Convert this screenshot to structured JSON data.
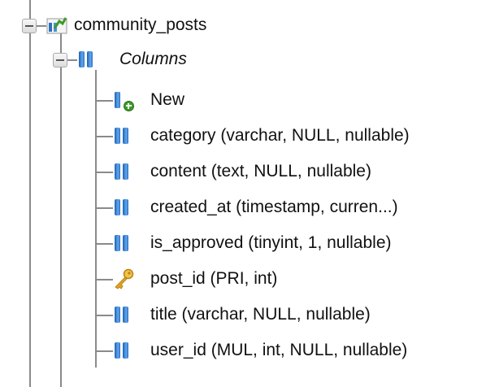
{
  "tree": {
    "table": {
      "label": "community_posts",
      "icon": "table-icon",
      "expander": "collapse"
    },
    "columns_group": {
      "label": "Columns",
      "icon": "columns-icon",
      "expander": "collapse"
    },
    "columns": [
      {
        "label": "New",
        "icon": "new-column-icon"
      },
      {
        "label": "category (varchar, NULL, nullable)",
        "icon": "column-icon"
      },
      {
        "label": "content (text, NULL, nullable)",
        "icon": "column-icon"
      },
      {
        "label": "created_at (timestamp, curren...)",
        "icon": "column-icon"
      },
      {
        "label": "is_approved (tinyint, 1, nullable)",
        "icon": "column-icon"
      },
      {
        "label": "post_id (PRI, int)",
        "icon": "key-icon"
      },
      {
        "label": "title (varchar, NULL, nullable)",
        "icon": "column-icon"
      },
      {
        "label": "user_id (MUL, int, NULL, nullable)",
        "icon": "column-icon"
      }
    ]
  },
  "colors": {
    "tree_line": "#8a8a8a",
    "column_icon_blue": "#2f6fbe",
    "key_icon_gold": "#e0a526",
    "new_badge_green": "#3d9a2a"
  }
}
